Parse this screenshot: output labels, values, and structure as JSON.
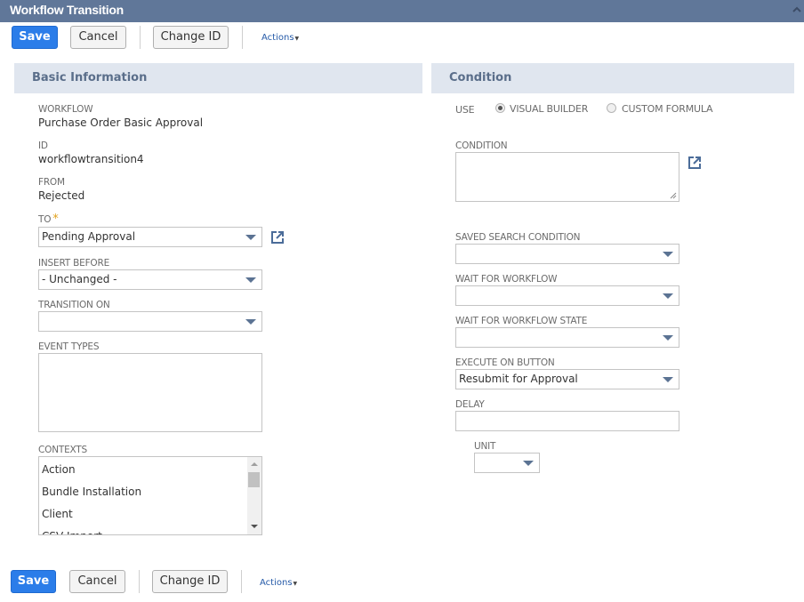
{
  "window": {
    "title": "Workflow Transition",
    "collapse_icon": "chevron-up-icon"
  },
  "toolbar": {
    "save_label": "Save",
    "cancel_label": "Cancel",
    "change_id_label": "Change ID",
    "actions_label": "Actions",
    "actions_icon": "dropdown-arrow-icon"
  },
  "basic_info": {
    "header": "Basic Information",
    "workflow": {
      "label": "WORKFLOW",
      "value": "Purchase Order Basic Approval"
    },
    "id": {
      "label": "ID",
      "value": "workflowtransition4"
    },
    "from": {
      "label": "FROM",
      "value": "Rejected"
    },
    "to": {
      "label": "TO",
      "required_marker": "*",
      "value": "Pending Approval"
    },
    "insert_before": {
      "label": "INSERT BEFORE",
      "value": "- Unchanged -"
    },
    "transition_on": {
      "label": "TRANSITION ON",
      "value": ""
    },
    "event_types": {
      "label": "EVENT TYPES",
      "options": []
    },
    "contexts": {
      "label": "CONTEXTS",
      "options": [
        "Action",
        "Bundle Installation",
        "Client",
        "CSV Import"
      ]
    }
  },
  "condition": {
    "header": "Condition",
    "use": {
      "label": "USE",
      "options": [
        {
          "label": "VISUAL BUILDER",
          "checked": true
        },
        {
          "label": "CUSTOM FORMULA",
          "checked": false
        }
      ]
    },
    "condition_field": {
      "label": "CONDITION",
      "value": ""
    },
    "saved_search_condition": {
      "label": "SAVED SEARCH CONDITION",
      "value": ""
    },
    "wait_for_workflow": {
      "label": "WAIT FOR WORKFLOW",
      "value": ""
    },
    "wait_for_workflow_state": {
      "label": "WAIT FOR WORKFLOW STATE",
      "value": ""
    },
    "execute_on_button": {
      "label": "EXECUTE ON BUTTON",
      "value": "Resubmit for Approval"
    },
    "delay": {
      "label": "DELAY",
      "value": ""
    },
    "unit": {
      "label": "UNIT",
      "value": ""
    }
  },
  "colors": {
    "titlebar": "#607799",
    "primary_button": "#2b7de9",
    "section_header_bg": "#e0e6ef",
    "section_header_text": "#5a6e8a",
    "required_marker": "#e2a11b",
    "link": "#255aa8"
  }
}
